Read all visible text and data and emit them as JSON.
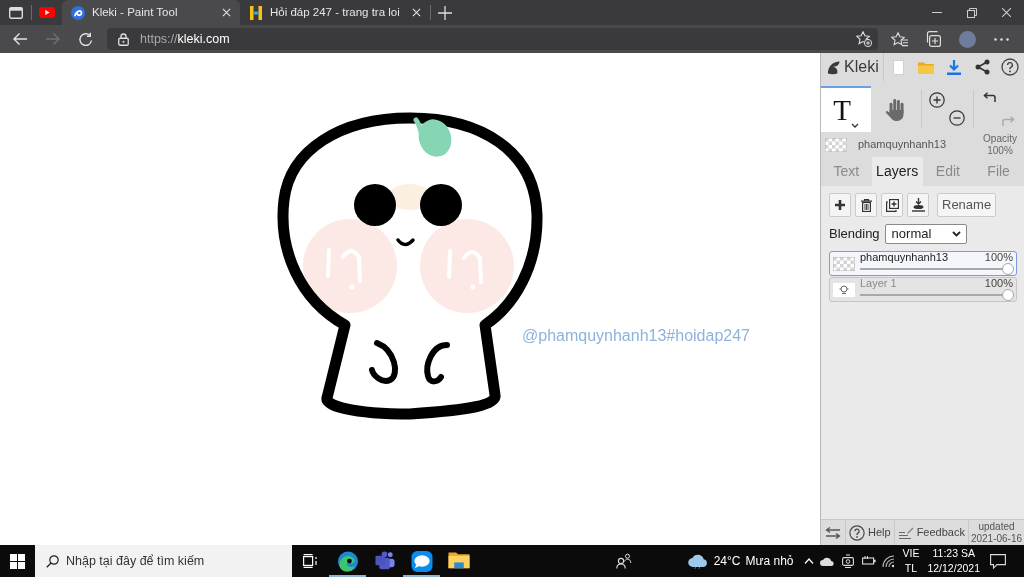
{
  "browser": {
    "tabs": [
      {
        "kind": "pinned",
        "selected": false
      },
      {
        "kind": "page",
        "title": "Kleki - Paint Tool",
        "selected": true
      },
      {
        "kind": "page",
        "title": "Hỏi đáp 247 - trang tra loi",
        "selected": false
      }
    ],
    "nav": [
      {
        "kind": "back",
        "disabled": false
      },
      {
        "kind": "forward",
        "disabled": true
      },
      {
        "kind": "refresh",
        "disabled": false
      }
    ],
    "url": "https://**kleki.com**"
  },
  "canvas": {
    "text": "@phamquynhanh13#hoidap247"
  },
  "panel": {
    "logo": "Kleki",
    "tools": [
      {
        "kind": "text",
        "label": "T",
        "selected": true
      },
      {
        "kind": "hand",
        "selected": false
      }
    ],
    "current_layer": {
      "name": "phamquynhanh13",
      "opacity_label": "Opacity",
      "opacity": "100%"
    },
    "tabs": [
      {
        "label": "Text",
        "selected": false
      },
      {
        "label": "Layers",
        "selected": true
      },
      {
        "label": "Edit",
        "selected": false
      },
      {
        "label": "File",
        "selected": false
      }
    ],
    "layer_actions": {
      "rename": "Rename"
    },
    "blending": {
      "label": "Blending",
      "value": "normal"
    },
    "layers": [
      {
        "kind": "transparent",
        "name": "phamquynhanh13",
        "opacity": "100%",
        "level": 1,
        "selected": true
      },
      {
        "kind": "sketch",
        "name": "Layer 1",
        "opacity": "100%",
        "level": 1,
        "selected": false
      }
    ],
    "footer": {
      "help": "Help",
      "feedback": "Feedback",
      "updated": "updated",
      "date": "2021-06-16"
    }
  },
  "taskbar": {
    "search": {
      "placeholder": "Nhập tại đây để tìm kiếm"
    },
    "apps": [
      {
        "kind": "edge",
        "running": true
      },
      {
        "kind": "teams",
        "running": false
      },
      {
        "kind": "zalo",
        "running": true
      },
      {
        "kind": "explorer",
        "running": false
      }
    ],
    "weather": {
      "temp": "24°C",
      "condition": "Mưa nhỏ"
    },
    "language": {
      "code": "VIE",
      "layout": "TL"
    },
    "clock": {
      "time": "11:23 SA",
      "date": "12/12/2021"
    }
  }
}
